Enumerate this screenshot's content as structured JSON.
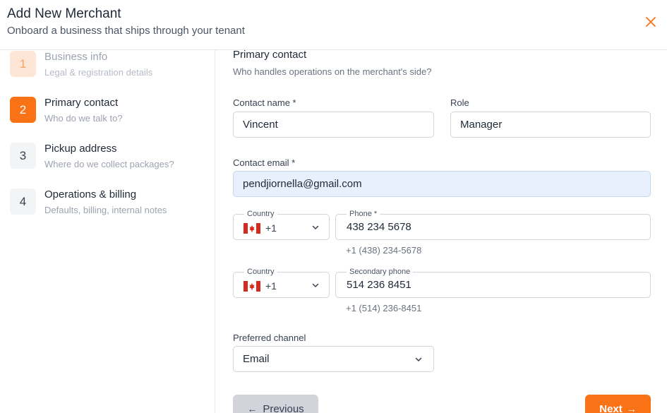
{
  "header": {
    "title": "Add New Merchant",
    "subtitle": "Onboard a business that ships through your tenant",
    "close_icon": "close-icon",
    "accent": "#f97316"
  },
  "steps": [
    {
      "num": "1",
      "title": "Business info",
      "desc": "Legal & registration details",
      "state": "done"
    },
    {
      "num": "2",
      "title": "Primary contact",
      "desc": "Who do we talk to?",
      "state": "active"
    },
    {
      "num": "3",
      "title": "Pickup address",
      "desc": "Where do we collect packages?",
      "state": "todo"
    },
    {
      "num": "4",
      "title": "Operations & billing",
      "desc": "Defaults, billing, internal notes",
      "state": "todo"
    }
  ],
  "form": {
    "section_title": "Primary contact",
    "section_subtitle": "Who handles operations on the merchant's side?",
    "contact_name": {
      "label": "Contact name *",
      "value": "Vincent"
    },
    "role": {
      "label": "Role",
      "value": "Manager"
    },
    "contact_email": {
      "label": "Contact email *",
      "value": "pendjiornella@gmail.com"
    },
    "phone": {
      "country_label": "Country",
      "country_code": "+1",
      "label": "Phone *",
      "value": "438 234 5678",
      "formatted": "+1 (438) 234-5678"
    },
    "secondary_phone": {
      "country_label": "Country",
      "country_code": "+1",
      "label": "Secondary phone",
      "value": "514 236 8451",
      "formatted": "+1 (514) 236-8451"
    },
    "preferred_channel": {
      "label": "Preferred channel",
      "value": "Email"
    }
  },
  "footer": {
    "previous_label": "Previous",
    "next_label": "Next"
  }
}
